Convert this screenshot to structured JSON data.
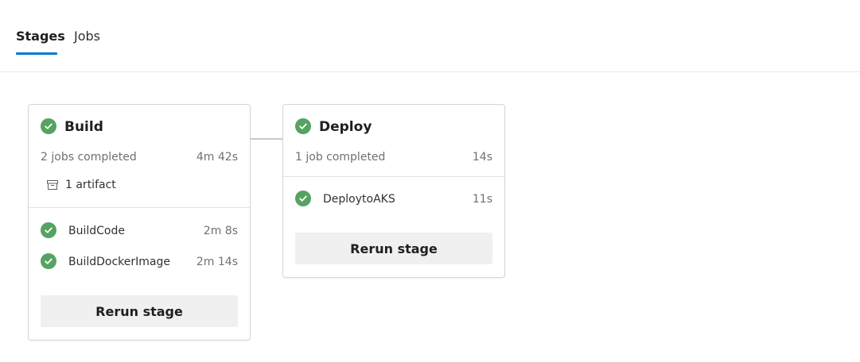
{
  "tabs": [
    {
      "label": "Stages",
      "active": true
    },
    {
      "label": "Jobs",
      "active": false
    }
  ],
  "stages": [
    {
      "name": "Build",
      "status": "succeeded",
      "summary": "2 jobs completed",
      "duration": "4m 42s",
      "artifact_label": "1 artifact",
      "jobs": [
        {
          "name": "BuildCode",
          "duration": "2m 8s",
          "status": "succeeded"
        },
        {
          "name": "BuildDockerImage",
          "duration": "2m 14s",
          "status": "succeeded"
        }
      ],
      "rerun_label": "Rerun stage"
    },
    {
      "name": "Deploy",
      "status": "succeeded",
      "summary": "1 job completed",
      "duration": "14s",
      "jobs": [
        {
          "name": "DeploytoAKS",
          "duration": "11s",
          "status": "succeeded"
        }
      ],
      "rerun_label": "Rerun stage"
    }
  ],
  "colors": {
    "accent": "#0078d4",
    "success": "#55a362"
  }
}
